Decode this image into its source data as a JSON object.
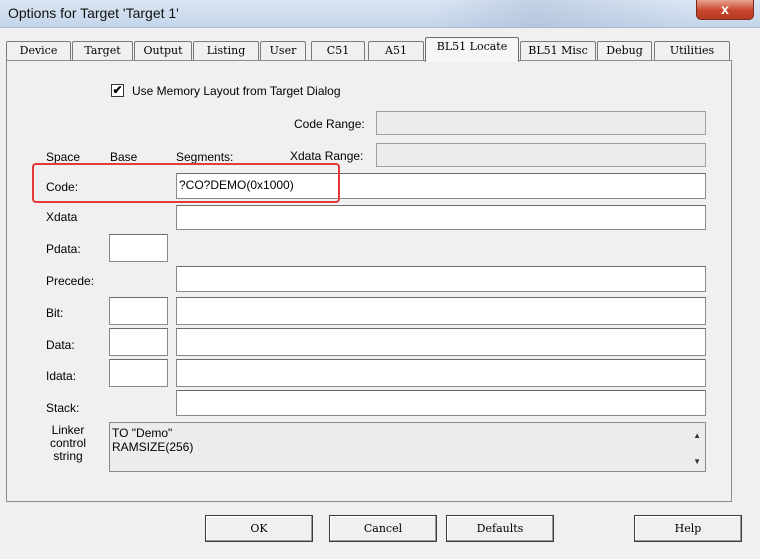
{
  "window": {
    "title": "Options for Target 'Target 1'",
    "close_label": "x"
  },
  "tabs": [
    {
      "label": "Device"
    },
    {
      "label": "Target"
    },
    {
      "label": "Output"
    },
    {
      "label": "Listing"
    },
    {
      "label": "User"
    },
    {
      "label": "C51"
    },
    {
      "label": "A51"
    },
    {
      "label": "BL51 Locate",
      "active": true
    },
    {
      "label": "BL51 Misc"
    },
    {
      "label": "Debug"
    },
    {
      "label": "Utilities"
    }
  ],
  "locate": {
    "use_memory_layout": {
      "label": "Use Memory Layout from Target Dialog",
      "checked": true,
      "mark": "✔"
    },
    "code_range": {
      "label": "Code Range:",
      "value": ""
    },
    "xdata_range": {
      "label": "Xdata Range:",
      "value": ""
    },
    "columns": {
      "space": "Space",
      "base": "Base",
      "segments": "Segments:"
    },
    "rows": {
      "code": {
        "label": "Code:",
        "segments": "?CO?DEMO(0x1000)"
      },
      "xdata": {
        "label": "Xdata",
        "segments": ""
      },
      "pdata": {
        "label": "Pdata:",
        "base": ""
      },
      "precede": {
        "label": "Precede:",
        "segments": ""
      },
      "bit": {
        "label": "Bit:",
        "base": "",
        "segments": ""
      },
      "data": {
        "label": "Data:",
        "base": "",
        "segments": ""
      },
      "idata": {
        "label": "Idata:",
        "base": "",
        "segments": ""
      },
      "stack": {
        "label": "Stack:",
        "segments": ""
      }
    },
    "linker": {
      "label_lines": [
        "Linker",
        "control",
        "string"
      ],
      "lines": [
        "TO \"Demo\"",
        "RAMSIZE(256)"
      ]
    }
  },
  "buttons": {
    "ok": "OK",
    "cancel": "Cancel",
    "defaults": "Defaults",
    "help": "Help"
  },
  "colors": {
    "highlight": "#e5393a",
    "close": "#c8452b"
  }
}
